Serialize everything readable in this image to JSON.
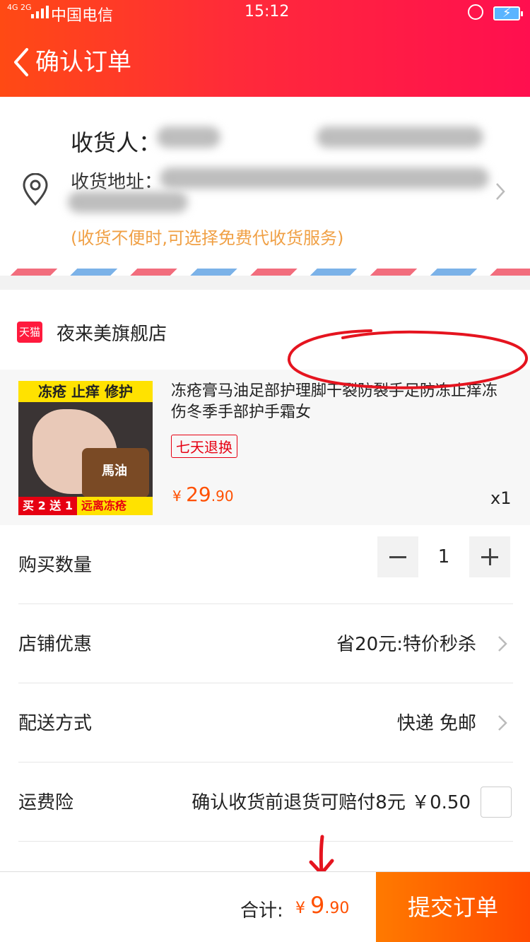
{
  "status_bar": {
    "network": "4G 2G",
    "carrier": "中国电信",
    "time": "15:12"
  },
  "header": {
    "title": "确认订单"
  },
  "address": {
    "recipient_label": "收货人：",
    "address_label": "收货地址：",
    "hint": "(收货不便时,可选择免费代收货服务)"
  },
  "store": {
    "badge": "天猫",
    "name": "夜来美旗舰店"
  },
  "product": {
    "title": "冻疮膏马油足部护理脚干裂防裂手足防冻止痒冻伤冬季手部护手霜女",
    "tag": "七天退换",
    "price_symbol": "¥ ",
    "price_int": "29",
    "price_dec": ".90",
    "quantity": "x1",
    "image_top_text": "冻疮 止痒 修护",
    "image_jar_text": "馬油",
    "image_bottom_left": "买 2 送 1",
    "image_bottom_right": "远离冻疮"
  },
  "rows": {
    "quantity_label": "购买数量",
    "quantity_value": "1",
    "discount_label": "店铺优惠",
    "discount_value": "省20元:特价秒杀",
    "delivery_label": "配送方式",
    "delivery_value": "快递 免邮",
    "insurance_label": "运费险",
    "insurance_value": "确认收货前退货可赔付8元  ￥0.50"
  },
  "footer": {
    "total_label": "合计:",
    "total_symbol": "¥ ",
    "total_int": "9",
    "total_dec": ".90",
    "submit_label": "提交订单"
  },
  "colors": {
    "header_start": "#ff4a14",
    "header_end": "#ff0f4f",
    "price": "#ff5000",
    "hint": "#f0a045",
    "submit": "#ff7a00",
    "annotation": "#e5141f"
  }
}
